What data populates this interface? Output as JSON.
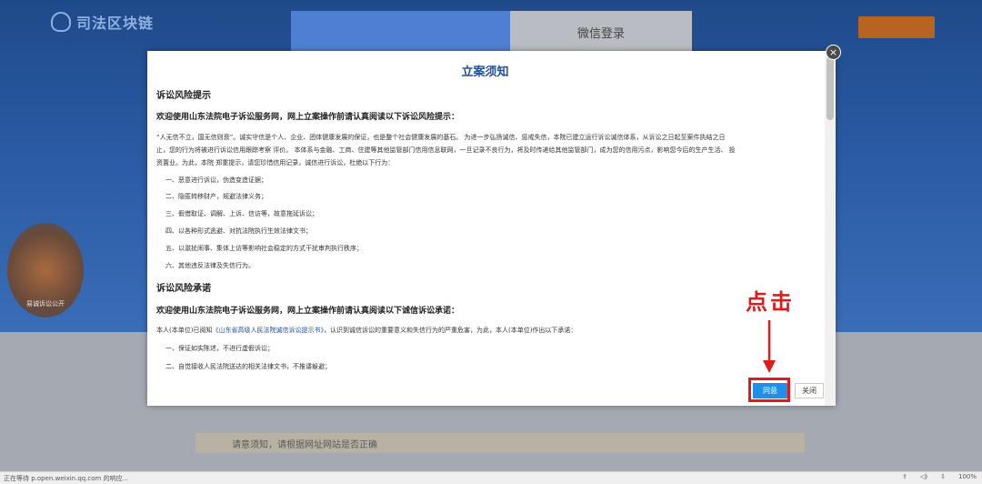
{
  "site": {
    "logo_text": "司法区块链"
  },
  "login_tabs": {
    "wechat_label": "微信登录"
  },
  "badge": {
    "caption": "易诚诉讼公开"
  },
  "modal": {
    "title": "立案须知",
    "close_icon": "×",
    "sections": [
      {
        "heading": "诉讼风险提示",
        "lead": "欢迎使用山东法院电子诉讼服务网，网上立案操作前请认真阅读以下诉讼风险提示：",
        "para_lines": [
          "“人无信不立，国无信则衰”。诚实守信是个人、企业、团体健康发展的保证，也是整个社会健康发展的基石。 为进一步弘扬诚信、惩戒失信，本院已建立运行诉讼诚信体系，从诉讼之日起至案件执结之日",
          "止，您的行为将被进行诉讼信用跟踪考察 评价。 本体系与金融、工商、住建等其他监管部门信用信息联网，一旦记录不良行为，将及时传递给其他监管部门，成为您的信用污点，影响您今后的生产生活、 投",
          "资置业。为此，本院 郑重提示，请您珍惜信用记录，诚信进行诉讼，杜绝以下行为："
        ],
        "items": [
          "一、恶意进行诉讼，伪造变造证据；",
          "二、隐匿转移财产，规避法律义务；",
          "三、假借取证、调解、上诉、信访等，故意拖延诉讼；",
          "四、以各种形式逃避、对抗法院执行生效法律文书；",
          "五、以滋扰闹事、集体上访等影响社会稳定的方式干扰审判执行秩序；",
          "六、其他违反法律及失信行为。"
        ]
      },
      {
        "heading": "诉讼风险承诺",
        "lead": "欢迎使用山东法院电子诉讼服务网，网上立案操作前请认真阅读以下诚信诉讼承诺：",
        "para_prefix": "本人(本单位)已阅知",
        "para_link": "《山东省高级人民法院诚信诉讼提示书》",
        "para_suffix": "，认识到诚信诉讼的重要意义和失信行为的严重危害，为此，本人(本单位)作出以下承诺：",
        "items": [
          "一、保证如实陈述，不进行虚假诉讼；",
          "二、自觉接收人民法院送达的相关法律文书，不推诿躲避；"
        ]
      }
    ],
    "buttons": {
      "agree": "同意",
      "close": "关闭"
    }
  },
  "annotation": {
    "text": "点击"
  },
  "background": {
    "strip_text": "请意须知，请根据网址网站是否正确"
  },
  "taskbar": {
    "status": "正在等待 p.open.weixin.qq.com 的响应...",
    "zoom": "100%"
  },
  "colors": {
    "accent": "#1e4f9e",
    "agree_button": "#1e90e8",
    "annotation_red": "#e01b1b"
  }
}
